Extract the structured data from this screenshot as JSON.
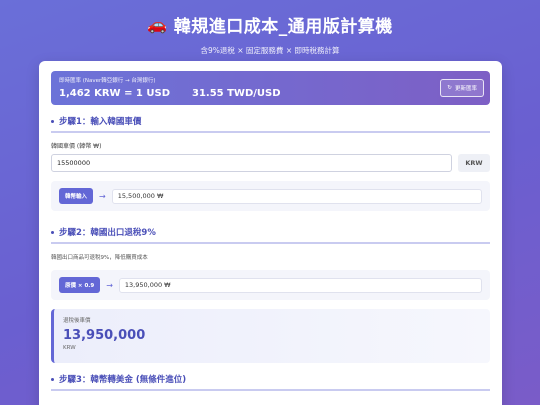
{
  "header": {
    "title": "韓規進口成本_通用版計算機",
    "car_icon": "car-icon",
    "subtitle": "含9%退稅 × 固定服務費 × 即時稅務計算"
  },
  "rate": {
    "source": "即時匯率 (Naver韓亞銀行 → 台灣銀行)",
    "krw_usd": "1,462 KRW = 1 USD",
    "twd_usd": "31.55 TWD/USD",
    "refresh_label": "更新匯率"
  },
  "step1": {
    "title": "步驟1：輸入韓國車價",
    "price_label": "韓國車價 (韓幣 ₩)",
    "price_value": "15500000",
    "unit": "KRW",
    "tag": "韓幣輸入",
    "converted": "15,500,000 ₩"
  },
  "step2": {
    "title": "步驟2：韓國出口退稅9%",
    "desc": "韓國出口商品可退稅9%，降低購買成本",
    "tag": "原價 × 0.9",
    "converted": "13,950,000 ₩",
    "result_label": "退稅後車價",
    "result_value": "13,950,000",
    "result_unit": "KRW"
  },
  "step3": {
    "title": "步驟3：韓幣轉美金 (無條件進位)"
  },
  "colors": {
    "accent": "#6367d6",
    "background_start": "#6a6fd8",
    "background_end": "#7a5cc8"
  }
}
